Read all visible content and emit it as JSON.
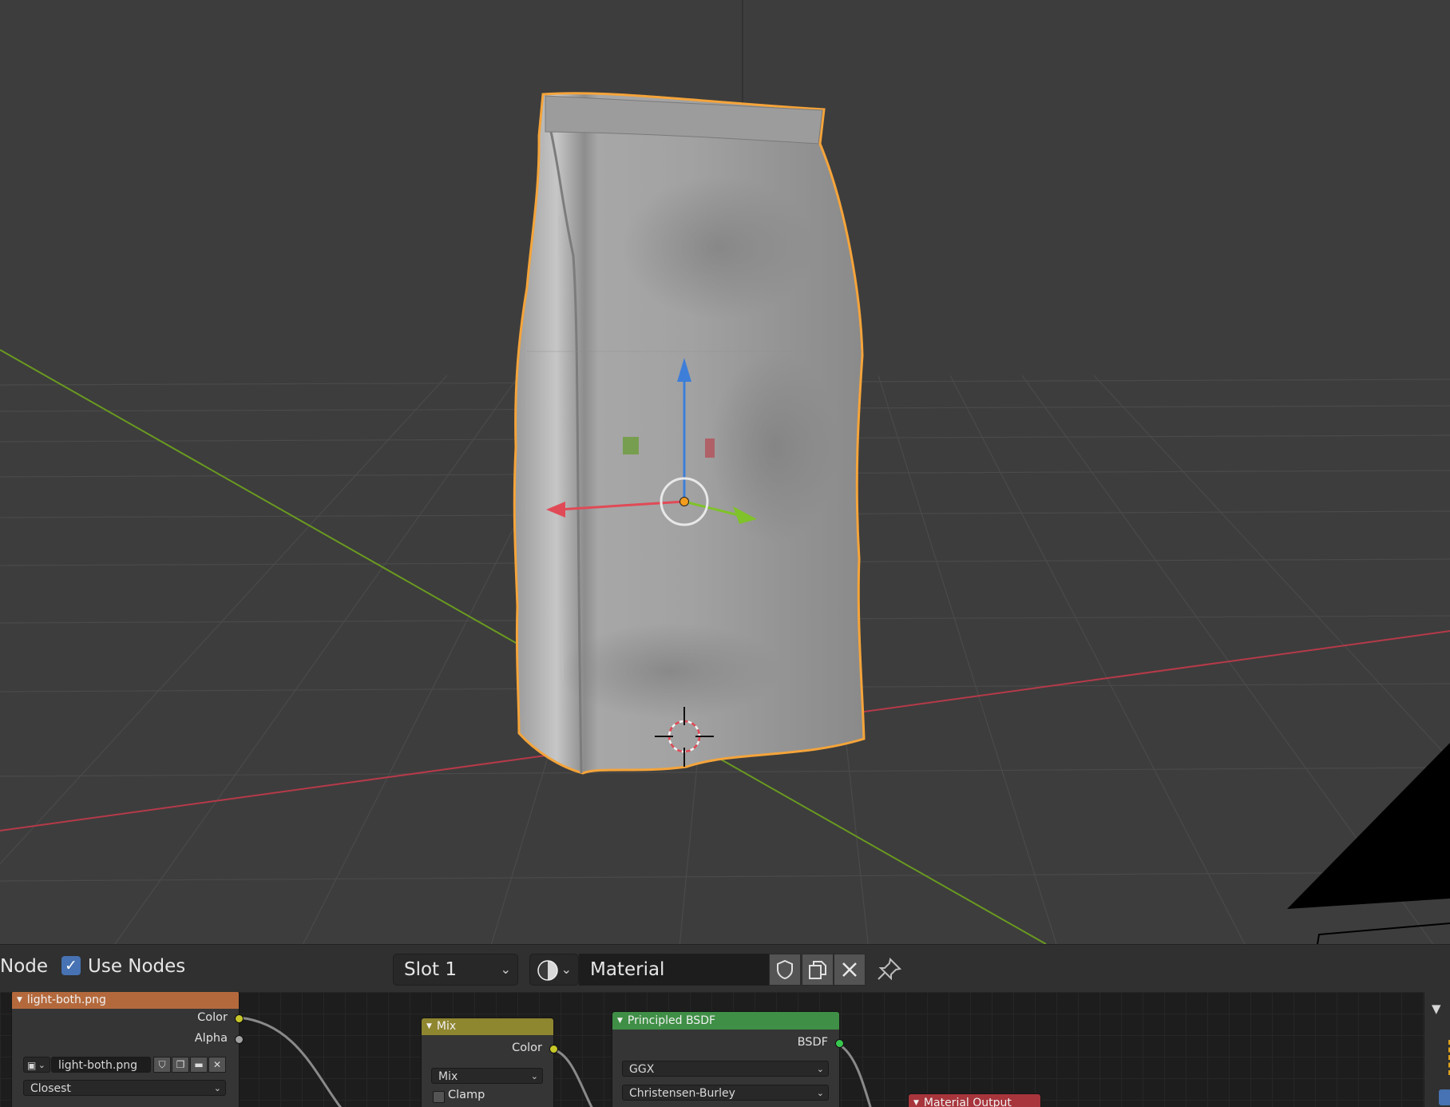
{
  "header": {
    "editor_label": "Node",
    "use_nodes_label": "Use Nodes",
    "use_nodes_checked": true,
    "slot_value": "Slot 1",
    "material_name": "Material"
  },
  "icons": {
    "material_preview": "material-sphere-icon",
    "fake_user": "shield-icon",
    "duplicate": "duplicate-icon",
    "unlink": "close-icon",
    "pin": "pin-icon"
  },
  "nodes": {
    "image": {
      "title": "light-both.png",
      "outputs": [
        "Color",
        "Alpha"
      ],
      "image_name": "light-both.png",
      "interpolation": "Closest",
      "color": "#b4693c"
    },
    "mix": {
      "title": "Mix",
      "output": "Color",
      "blend_type": "Mix",
      "clamp_label": "Clamp",
      "color": "#8f8630"
    },
    "principled": {
      "title": "Principled BSDF",
      "output": "BSDF",
      "distribution": "GGX",
      "subsurface_method": "Christensen-Burley",
      "color": "#3f8f46"
    },
    "output": {
      "title": "Material Output",
      "color": "#a8353c"
    }
  },
  "viewport": {
    "selection_color": "#f5a43a",
    "x_axis_color": "#b53a49",
    "y_axis_color": "#6a9a20"
  }
}
